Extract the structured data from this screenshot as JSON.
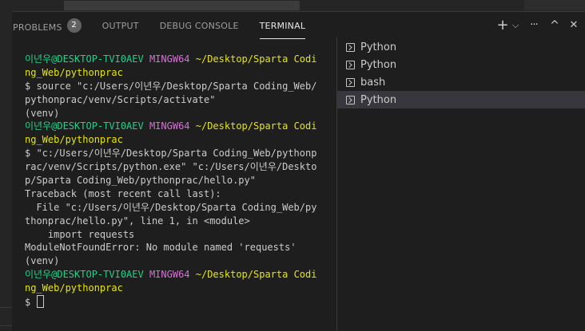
{
  "panel_tabs": [
    {
      "label": "PROBLEMS",
      "badge": "2"
    },
    {
      "label": "OUTPUT"
    },
    {
      "label": "DEBUG CONSOLE"
    },
    {
      "label": "TERMINAL"
    }
  ],
  "actions": {
    "new_terminal": "+",
    "dropdown": "⌵",
    "more": "···",
    "maximize": "^",
    "close": "✕"
  },
  "terminal": {
    "lines": [
      [
        {
          "t": "이년우@DESKTOP-TVI0AEV ",
          "c": "g"
        },
        {
          "t": "MINGW64 ",
          "c": "m"
        },
        {
          "t": "~/Desktop/Sparta Codi",
          "c": "y"
        }
      ],
      [
        {
          "t": "ng_Web/pythonprac",
          "c": "y"
        }
      ],
      [
        {
          "t": "$ source \"c:/Users/이년우/Desktop/Sparta Coding_Web/",
          "c": ""
        }
      ],
      [
        {
          "t": "pythonprac/venv/Scripts/activate\"",
          "c": ""
        }
      ],
      [
        {
          "t": "(venv)",
          "c": ""
        }
      ],
      [
        {
          "t": "이년우@DESKTOP-TVI0AEV ",
          "c": "g"
        },
        {
          "t": "MINGW64 ",
          "c": "m"
        },
        {
          "t": "~/Desktop/Sparta Codi",
          "c": "y"
        }
      ],
      [
        {
          "t": "ng_Web/pythonprac",
          "c": "y"
        }
      ],
      [
        {
          "t": "$ \"c:/Users/이년우/Desktop/Sparta Coding_Web/pythonp",
          "c": ""
        }
      ],
      [
        {
          "t": "rac/venv/Scripts/python.exe\" \"c:/Users/이년우/Deskto",
          "c": ""
        }
      ],
      [
        {
          "t": "p/Sparta Coding_Web/pythonprac/hello.py\"",
          "c": ""
        }
      ],
      [
        {
          "t": "Traceback (most recent call last):",
          "c": ""
        }
      ],
      [
        {
          "t": "  File \"c:/Users/이년우/Desktop/Sparta Coding_Web/py",
          "c": ""
        }
      ],
      [
        {
          "t": "thonprac/hello.py\", line 1, in <module>",
          "c": ""
        }
      ],
      [
        {
          "t": "    import requests",
          "c": ""
        }
      ],
      [
        {
          "t": "ModuleNotFoundError: No module named 'requests'",
          "c": ""
        }
      ],
      [
        {
          "t": "(venv)",
          "c": ""
        }
      ],
      [
        {
          "t": "이년우@DESKTOP-TVI0AEV ",
          "c": "g"
        },
        {
          "t": "MINGW64 ",
          "c": "m"
        },
        {
          "t": "~/Desktop/Sparta Codi",
          "c": "y"
        }
      ],
      [
        {
          "t": "ng_Web/pythonprac",
          "c": "y"
        }
      ],
      [
        {
          "t": "$ ",
          "c": ""
        }
      ]
    ]
  },
  "terminal_list": [
    {
      "label": "Python",
      "selected": false
    },
    {
      "label": "Python",
      "selected": false
    },
    {
      "label": "bash",
      "selected": false
    },
    {
      "label": "Python",
      "selected": true
    }
  ],
  "colors": {
    "prompt_user": "#23d18b",
    "prompt_shell": "#d670d6",
    "prompt_path": "#e5e510",
    "selected_item": "#37373d"
  }
}
